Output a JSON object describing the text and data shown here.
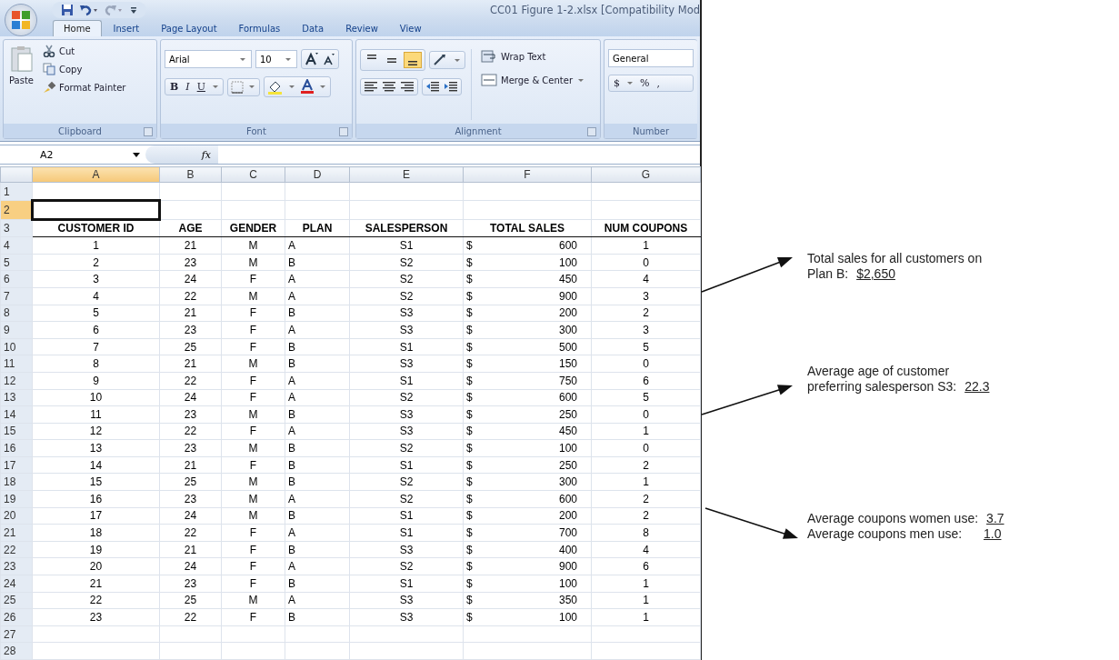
{
  "window": {
    "title": "CC01 Figure 1-2.xlsx  [Compatibility Mod"
  },
  "tabs": [
    {
      "label": "Home",
      "selected": true
    },
    {
      "label": "Insert",
      "selected": false
    },
    {
      "label": "Page Layout",
      "selected": false
    },
    {
      "label": "Formulas",
      "selected": false
    },
    {
      "label": "Data",
      "selected": false
    },
    {
      "label": "Review",
      "selected": false
    },
    {
      "label": "View",
      "selected": false
    }
  ],
  "ribbon": {
    "clipboard": {
      "paste": "Paste",
      "cut": "Cut",
      "copy": "Copy",
      "format_painter": "Format Painter",
      "label": "Clipboard"
    },
    "font": {
      "family": "Arial",
      "size": "10",
      "bold": "B",
      "italic": "I",
      "underline": "U",
      "label": "Font"
    },
    "alignment": {
      "vertical_align": [
        {
          "selected": false
        },
        {
          "selected": false
        },
        {
          "selected": true
        }
      ],
      "wrap_text": "Wrap Text",
      "merge": "Merge & Center",
      "label": "Alignment"
    },
    "number": {
      "format": "General",
      "currency": "$",
      "percent": "%",
      "comma": ",",
      "label": "Number"
    }
  },
  "formula_bar": {
    "name_box": "A2",
    "function_label": "fx"
  },
  "sheet": {
    "columns": [
      {
        "label": "A",
        "selected": true
      },
      {
        "label": "B",
        "selected": false
      },
      {
        "label": "C",
        "selected": false
      },
      {
        "label": "D",
        "selected": false
      },
      {
        "label": "E",
        "selected": false
      },
      {
        "label": "F",
        "selected": false
      },
      {
        "label": "G",
        "selected": false
      }
    ],
    "rows": [
      {
        "number": "1",
        "selected": false,
        "kind": "blank"
      },
      {
        "number": "2",
        "selected": true,
        "kind": "blank"
      },
      {
        "number": "3",
        "selected": false,
        "kind": "header",
        "cells": [
          "CUSTOMER ID",
          "AGE",
          "GENDER",
          "PLAN",
          "SALESPERSON",
          "TOTAL SALES",
          "NUM COUPONS"
        ]
      },
      {
        "number": "4",
        "selected": false,
        "kind": "record",
        "record": {
          "id": "1",
          "age": "21",
          "gender": "M",
          "plan": "A",
          "salesperson": "S1",
          "currency": "$",
          "total_sales": "600",
          "num_coupons": "1"
        }
      },
      {
        "number": "5",
        "selected": false,
        "kind": "record",
        "record": {
          "id": "2",
          "age": "23",
          "gender": "M",
          "plan": "B",
          "salesperson": "S2",
          "currency": "$",
          "total_sales": "100",
          "num_coupons": "0"
        }
      },
      {
        "number": "6",
        "selected": false,
        "kind": "record",
        "record": {
          "id": "3",
          "age": "24",
          "gender": "F",
          "plan": "A",
          "salesperson": "S2",
          "currency": "$",
          "total_sales": "450",
          "num_coupons": "4"
        }
      },
      {
        "number": "7",
        "selected": false,
        "kind": "record",
        "record": {
          "id": "4",
          "age": "22",
          "gender": "M",
          "plan": "A",
          "salesperson": "S2",
          "currency": "$",
          "total_sales": "900",
          "num_coupons": "3"
        }
      },
      {
        "number": "8",
        "selected": false,
        "kind": "record",
        "record": {
          "id": "5",
          "age": "21",
          "gender": "F",
          "plan": "B",
          "salesperson": "S3",
          "currency": "$",
          "total_sales": "200",
          "num_coupons": "2"
        }
      },
      {
        "number": "9",
        "selected": false,
        "kind": "record",
        "record": {
          "id": "6",
          "age": "23",
          "gender": "F",
          "plan": "A",
          "salesperson": "S3",
          "currency": "$",
          "total_sales": "300",
          "num_coupons": "3"
        }
      },
      {
        "number": "10",
        "selected": false,
        "kind": "record",
        "record": {
          "id": "7",
          "age": "25",
          "gender": "F",
          "plan": "B",
          "salesperson": "S1",
          "currency": "$",
          "total_sales": "500",
          "num_coupons": "5"
        }
      },
      {
        "number": "11",
        "selected": false,
        "kind": "record",
        "record": {
          "id": "8",
          "age": "21",
          "gender": "M",
          "plan": "B",
          "salesperson": "S3",
          "currency": "$",
          "total_sales": "150",
          "num_coupons": "0"
        }
      },
      {
        "number": "12",
        "selected": false,
        "kind": "record",
        "record": {
          "id": "9",
          "age": "22",
          "gender": "F",
          "plan": "A",
          "salesperson": "S1",
          "currency": "$",
          "total_sales": "750",
          "num_coupons": "6"
        }
      },
      {
        "number": "13",
        "selected": false,
        "kind": "record",
        "record": {
          "id": "10",
          "age": "24",
          "gender": "F",
          "plan": "A",
          "salesperson": "S2",
          "currency": "$",
          "total_sales": "600",
          "num_coupons": "5"
        }
      },
      {
        "number": "14",
        "selected": false,
        "kind": "record",
        "record": {
          "id": "11",
          "age": "23",
          "gender": "M",
          "plan": "B",
          "salesperson": "S3",
          "currency": "$",
          "total_sales": "250",
          "num_coupons": "0"
        }
      },
      {
        "number": "15",
        "selected": false,
        "kind": "record",
        "record": {
          "id": "12",
          "age": "22",
          "gender": "F",
          "plan": "A",
          "salesperson": "S3",
          "currency": "$",
          "total_sales": "450",
          "num_coupons": "1"
        }
      },
      {
        "number": "16",
        "selected": false,
        "kind": "record",
        "record": {
          "id": "13",
          "age": "23",
          "gender": "M",
          "plan": "B",
          "salesperson": "S2",
          "currency": "$",
          "total_sales": "100",
          "num_coupons": "0"
        }
      },
      {
        "number": "17",
        "selected": false,
        "kind": "record",
        "record": {
          "id": "14",
          "age": "21",
          "gender": "F",
          "plan": "B",
          "salesperson": "S1",
          "currency": "$",
          "total_sales": "250",
          "num_coupons": "2"
        }
      },
      {
        "number": "18",
        "selected": false,
        "kind": "record",
        "record": {
          "id": "15",
          "age": "25",
          "gender": "M",
          "plan": "B",
          "salesperson": "S2",
          "currency": "$",
          "total_sales": "300",
          "num_coupons": "1"
        }
      },
      {
        "number": "19",
        "selected": false,
        "kind": "record",
        "record": {
          "id": "16",
          "age": "23",
          "gender": "M",
          "plan": "A",
          "salesperson": "S2",
          "currency": "$",
          "total_sales": "600",
          "num_coupons": "2"
        }
      },
      {
        "number": "20",
        "selected": false,
        "kind": "record",
        "record": {
          "id": "17",
          "age": "24",
          "gender": "M",
          "plan": "B",
          "salesperson": "S1",
          "currency": "$",
          "total_sales": "200",
          "num_coupons": "2"
        }
      },
      {
        "number": "21",
        "selected": false,
        "kind": "record",
        "record": {
          "id": "18",
          "age": "22",
          "gender": "F",
          "plan": "A",
          "salesperson": "S1",
          "currency": "$",
          "total_sales": "700",
          "num_coupons": "8"
        }
      },
      {
        "number": "22",
        "selected": false,
        "kind": "record",
        "record": {
          "id": "19",
          "age": "21",
          "gender": "F",
          "plan": "B",
          "salesperson": "S3",
          "currency": "$",
          "total_sales": "400",
          "num_coupons": "4"
        }
      },
      {
        "number": "23",
        "selected": false,
        "kind": "record",
        "record": {
          "id": "20",
          "age": "24",
          "gender": "F",
          "plan": "A",
          "salesperson": "S2",
          "currency": "$",
          "total_sales": "900",
          "num_coupons": "6"
        }
      },
      {
        "number": "24",
        "selected": false,
        "kind": "record",
        "record": {
          "id": "21",
          "age": "23",
          "gender": "F",
          "plan": "B",
          "salesperson": "S1",
          "currency": "$",
          "total_sales": "100",
          "num_coupons": "1"
        }
      },
      {
        "number": "25",
        "selected": false,
        "kind": "record",
        "record": {
          "id": "22",
          "age": "25",
          "gender": "M",
          "plan": "A",
          "salesperson": "S3",
          "currency": "$",
          "total_sales": "350",
          "num_coupons": "1"
        }
      },
      {
        "number": "26",
        "selected": false,
        "kind": "record",
        "record": {
          "id": "23",
          "age": "22",
          "gender": "F",
          "plan": "B",
          "salesperson": "S3",
          "currency": "$",
          "total_sales": "100",
          "num_coupons": "1"
        }
      },
      {
        "number": "27",
        "selected": false,
        "kind": "blank"
      },
      {
        "number": "28",
        "selected": false,
        "kind": "blank"
      }
    ]
  },
  "annotations": [
    {
      "lines": [
        {
          "text": "Total sales for all customers on"
        },
        {
          "text": "Plan B:",
          "value": "$2,650"
        }
      ]
    },
    {
      "lines": [
        {
          "text": "Average age of customer"
        },
        {
          "text": "preferring salesperson S3:",
          "value": "22.3"
        }
      ]
    },
    {
      "lines": [
        {
          "text": "Average coupons women use:",
          "value": "3.7"
        },
        {
          "text": "Average coupons men use:",
          "value": "1.0"
        }
      ]
    }
  ]
}
